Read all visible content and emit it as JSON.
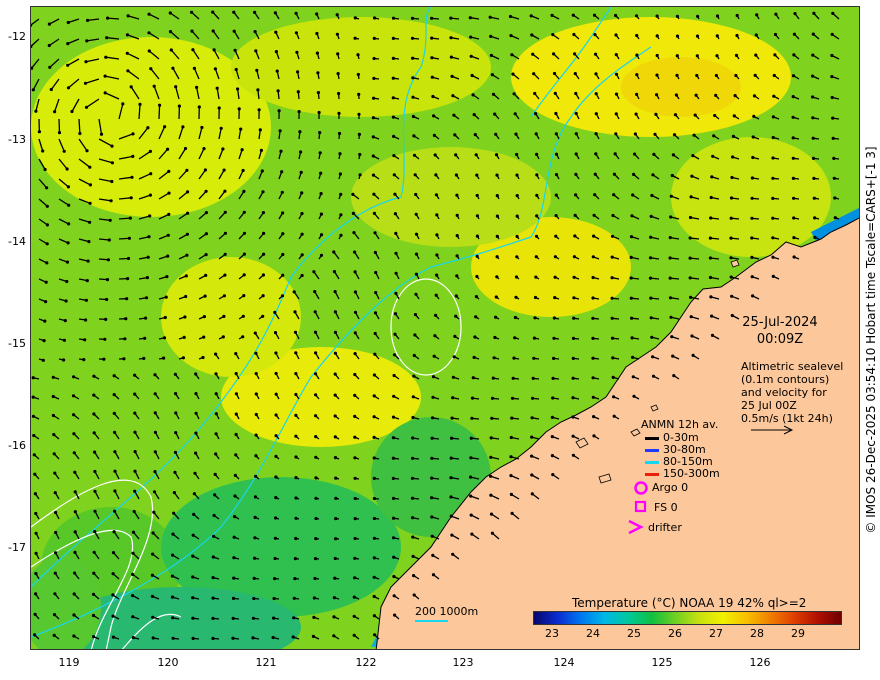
{
  "map": {
    "y_ticks": [
      "-12",
      "-13",
      "-14",
      "-15",
      "-16",
      "-17"
    ],
    "x_ticks": [
      "119",
      "120",
      "121",
      "122",
      "123",
      "124",
      "125",
      "126"
    ],
    "credit": "© IMOS 26-Dec-2025 03:54:10 Hobart time Tscale=CARS+[-1 3]",
    "date": "25-Jul-2024",
    "time": "00:09Z",
    "description": [
      "Altimetric sealevel",
      "(0.1m contours)",
      "and velocity for",
      "25 Jul 00Z",
      "0.5m/s (1kt 24h)"
    ],
    "legend_title": "ANMN 12h av.",
    "depth_bins": [
      {
        "label": "0-30m",
        "color": "#000000"
      },
      {
        "label": "30-80m",
        "color": "#1f3bff"
      },
      {
        "label": "80-150m",
        "color": "#19d5ef"
      },
      {
        "label": "150-300m",
        "color": "#e8200a"
      }
    ],
    "argo_label": "Argo 0",
    "fs_label": "FS 0",
    "drifter_label": "drifter",
    "marker_color": "#ff00ff",
    "colorbar_title": "Temperature (°C) NOAA 19 42% ql>=2",
    "colorbar_ticks": [
      "23",
      "24",
      "25",
      "26",
      "27",
      "28",
      "29"
    ],
    "isobath_label": "200  1000m",
    "land_color": "#fcc89b",
    "isobath_color": "#19d5ef"
  }
}
